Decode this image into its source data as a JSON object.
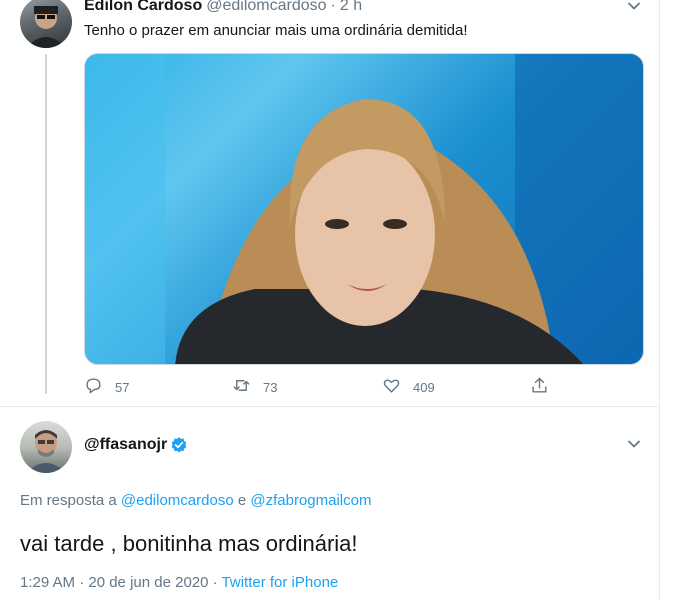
{
  "tweet1": {
    "name": "Edilon Cardoso",
    "handle": "@edilomcardoso",
    "separator": "·",
    "time": "2 h",
    "text": "Tenho o prazer em anunciar mais uma ordinária demitida!",
    "stats": {
      "replies": "57",
      "retweets": "73",
      "likes": "409"
    }
  },
  "tweet2": {
    "handle": "@ffasanojr",
    "reply_prefix": "Em resposta a",
    "mention1": "@edilomcardoso",
    "reply_conjunction": "e",
    "mention2": "@zfabrogmailcom",
    "text": "vai tarde , bonitinha mas ordinária!",
    "timestamp": "1:29 AM · 20 de jun de 2020 ·",
    "source": "Twitter for iPhone"
  },
  "icons": {
    "reply": "reply-icon",
    "retweet": "retweet-icon",
    "like": "heart-icon",
    "share": "share-icon",
    "caret": "chevron-down-icon",
    "verified": "verified-badge-icon"
  },
  "colors": {
    "accent": "#1da1f2",
    "muted": "#657786",
    "text": "#14171a"
  }
}
